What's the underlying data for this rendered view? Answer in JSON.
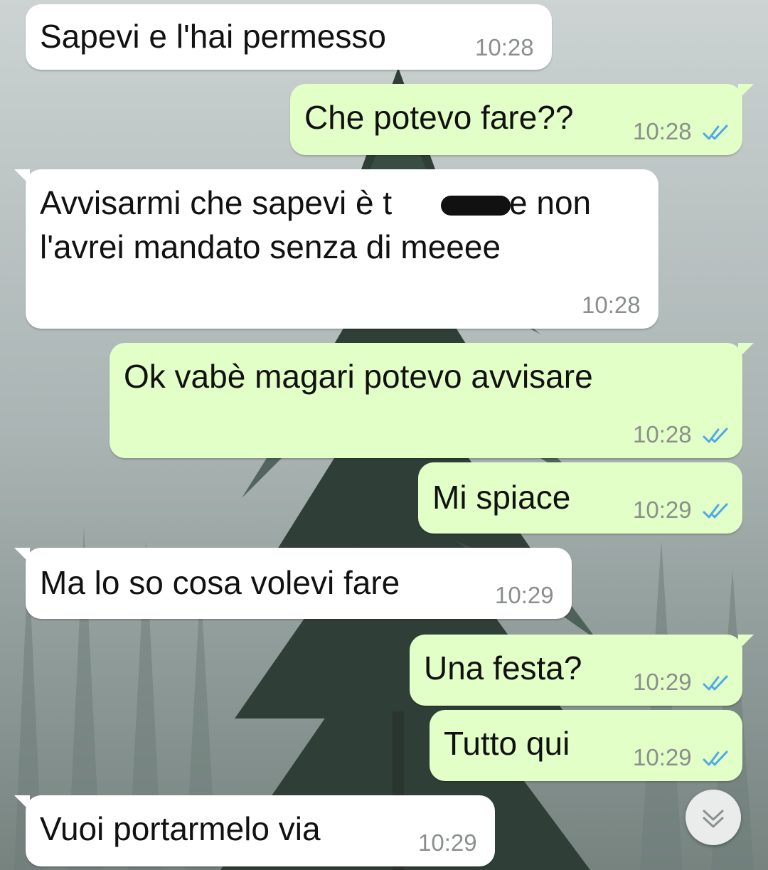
{
  "messages": [
    {
      "direction": "incoming",
      "text": "Sapevi e l'hai permesso",
      "time": "10:28"
    },
    {
      "direction": "outgoing",
      "text": "Che potevo fare??",
      "time": "10:28",
      "status": "read-ticks-icon"
    },
    {
      "direction": "incoming",
      "text_line1_a": "Avvisarmi che sapevi è t",
      "text_line1_b": "e non",
      "text_line2": "l'avrei mandato senza di meeee",
      "time": "10:28"
    },
    {
      "direction": "outgoing",
      "text": "Ok vabè magari potevo avvisare",
      "time": "10:28",
      "status": "read-ticks-icon"
    },
    {
      "direction": "outgoing",
      "text": "Mi spiace",
      "time": "10:29",
      "status": "read-ticks-icon"
    },
    {
      "direction": "incoming",
      "text": "Ma lo so cosa volevi fare",
      "time": "10:29"
    },
    {
      "direction": "outgoing",
      "text": "Una festa?",
      "time": "10:29",
      "status": "read-ticks-icon"
    },
    {
      "direction": "outgoing",
      "text": "Tutto qui",
      "time": "10:29",
      "status": "read-ticks-icon"
    },
    {
      "direction": "incoming",
      "text": "Vuoi portarmelo via",
      "time": "10:29"
    }
  ],
  "scroll_button": {
    "icon": "chevron-double-down-icon"
  },
  "colors": {
    "incoming_bubble": "#ffffff",
    "outgoing_bubble": "#e2ffc7",
    "tick_read": "#4fa8e8",
    "timestamp": "#8a8f8b",
    "header_accent": "#2a7f6f"
  }
}
